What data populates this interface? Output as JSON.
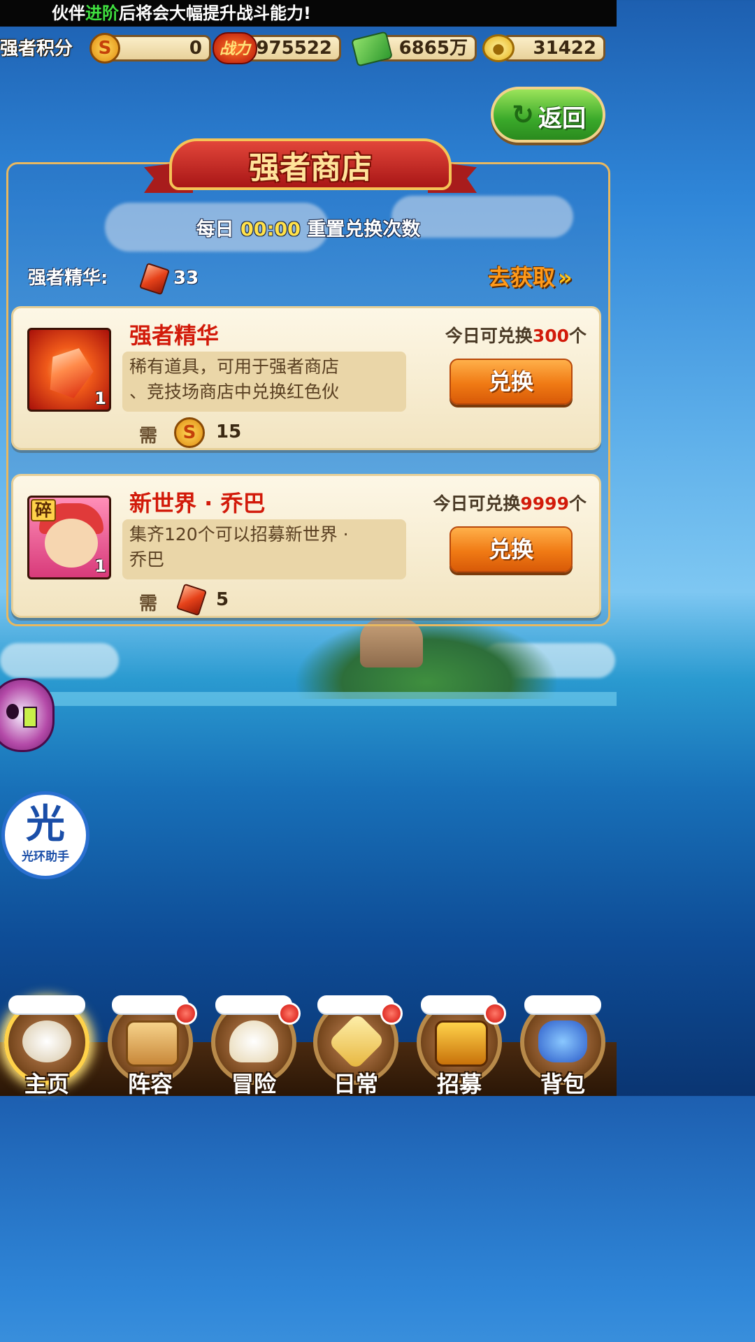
{
  "top_banner": {
    "prefix": "伙伴",
    "highlight": "进阶",
    "suffix": "后将会大幅提升战斗能力!"
  },
  "currencies": {
    "strong_points_label": "强者积分",
    "strong_points": "0",
    "power_icon_text": "战力",
    "power": "975522",
    "cash": "6865万",
    "gold": "31422",
    "coin_symbol": "S"
  },
  "back_button": {
    "label": "返回",
    "icon": "return-arrow-icon"
  },
  "shop": {
    "title": "强者商店",
    "reset_prefix": "每日",
    "reset_time": "00:00",
    "reset_suffix": "重置兑换次数",
    "essence_label": "强者精华:",
    "essence_count": "33",
    "go_get_label": "去获取"
  },
  "items": [
    {
      "name": "强者精华",
      "qty": "1",
      "desc_line1": "稀有道具，可用于强者商店",
      "desc_line2": "、竞技场商店中兑换红色伙",
      "limit_prefix": "今日可兑换",
      "limit_value": "300",
      "limit_suffix": "个",
      "need_label": "需",
      "cost": "15",
      "cost_currency": "strong-points-coin",
      "button_label": "兑换"
    },
    {
      "name": "新世界 · 乔巴",
      "qty": "1",
      "shard_label": "碎",
      "desc_line1": "集齐120个可以招募新世界 ·",
      "desc_line2": "乔巴",
      "limit_prefix": "今日可兑换",
      "limit_value": "9999",
      "limit_suffix": "个",
      "need_label": "需",
      "cost": "5",
      "cost_currency": "strong-essence-gem",
      "button_label": "兑换"
    }
  ],
  "helpers": {
    "halo_big": "光",
    "halo_small": "光环助手"
  },
  "nav": [
    {
      "label": "主页",
      "icon": "home-icon",
      "badge": false,
      "active": true
    },
    {
      "label": "阵容",
      "icon": "lineup-icon",
      "badge": true,
      "active": false
    },
    {
      "label": "冒险",
      "icon": "adventure-skull-icon",
      "badge": true,
      "active": false
    },
    {
      "label": "日常",
      "icon": "daily-swords-icon",
      "badge": true,
      "active": false
    },
    {
      "label": "招募",
      "icon": "recruit-bar-icon",
      "badge": true,
      "active": false
    },
    {
      "label": "背包",
      "icon": "backpack-icon",
      "badge": false,
      "active": false
    }
  ],
  "colors": {
    "accent_red": "#d21a0a",
    "highlight_green": "#3fe03f",
    "time_yellow": "#ffe14a",
    "button_orange": "#f07a14"
  }
}
